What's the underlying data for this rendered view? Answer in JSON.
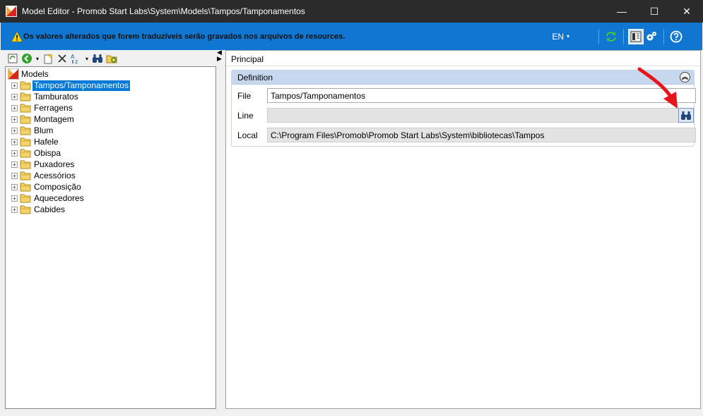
{
  "window": {
    "title": "Model Editor - Promob Start Labs\\System\\Models\\Tampos/Tamponamentos",
    "minimize": "—",
    "maximize": "☐",
    "close": "✕"
  },
  "infobar": {
    "message": "Os valores alterados que forem traduzíveis serão gravados nos arquivos de resources.",
    "language": "EN",
    "language_caret": "▾",
    "accent": "#0f77d2",
    "icons": [
      "refresh-icon",
      "panel-layout-icon",
      "settings-icon",
      "help-icon"
    ]
  },
  "toolbar": {
    "icons": [
      "refresh-icon",
      "back-icon",
      "dropdown-caret-icon",
      "new-item-icon",
      "delete-icon",
      "sort-icon",
      "dropdown-caret-icon",
      "find-icon",
      "folder-refresh-icon"
    ]
  },
  "tree": {
    "root": "Models",
    "nodes": [
      {
        "label": "Tampos/Tamponamentos",
        "selected": true
      },
      {
        "label": "Tamburatos"
      },
      {
        "label": "Ferragens"
      },
      {
        "label": "Montagem"
      },
      {
        "label": "Blum"
      },
      {
        "label": "Hafele"
      },
      {
        "label": "Obispa"
      },
      {
        "label": "Puxadores"
      },
      {
        "label": "Acessórios"
      },
      {
        "label": "Composição"
      },
      {
        "label": "Aquecedores"
      },
      {
        "label": "Cabides"
      }
    ],
    "expander": "+"
  },
  "splitter": {
    "up": "◀",
    "down": "▶"
  },
  "details": {
    "tab": "Principal",
    "group_title": "Definition",
    "collapse_symbol": "︽",
    "fields": {
      "file_label": "File",
      "file_value": "Tampos/Tamponamentos",
      "line_label": "Line",
      "line_value": "",
      "local_label": "Local",
      "local_value": "C:\\Program Files\\Promob\\Promob Start Labs\\System\\bibliotecas\\Tampos"
    }
  },
  "annotation": {
    "color": "#e8141b"
  }
}
